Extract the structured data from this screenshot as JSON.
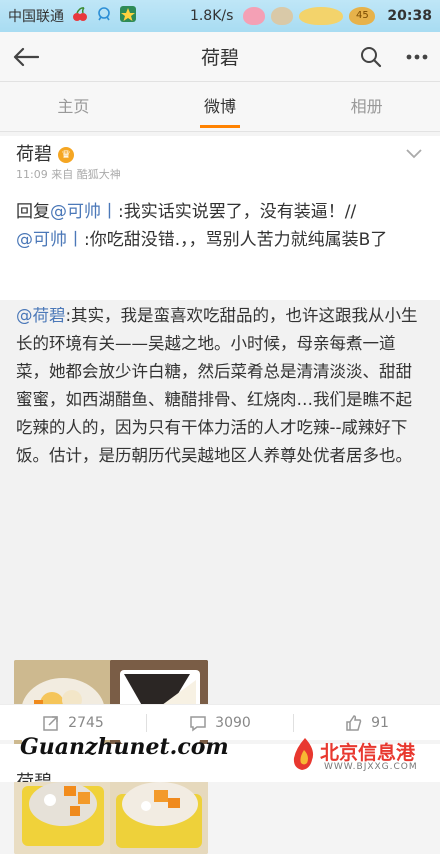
{
  "status_bar": {
    "carrier": "中国联通",
    "speed": "1.8K/s",
    "badge_45": "45",
    "time": "20:38"
  },
  "topbar": {
    "title": "荷碧"
  },
  "tabs": [
    {
      "label": "主页"
    },
    {
      "label": "微博"
    },
    {
      "label": "相册"
    }
  ],
  "post": {
    "author": "荷碧",
    "vip_badge": "♛",
    "meta": "11:09 来自 酷狐大神",
    "reply_prefix": "回复",
    "mention_1": "@可帅丨",
    "text_1": ":我实话实说罢了，没有装逼！//",
    "mention_2": "@可帅丨",
    "text_2": ":你吃甜没错.，，骂别人苦力就纯属装B了"
  },
  "quoted": {
    "mention": "@荷碧",
    "text": ":其实，我是蛮喜欢吃甜品的，也许这跟我从小生长的环境有关——吴越之地。小时候，母亲每煮一道菜，她都会放少许白糖，然后菜肴总是清清淡淡、甜甜蜜蜜，如西湖醋鱼、糖醋排骨、红烧肉…我们是瞧不起吃辣的人的，因为只有干体力活的人才吃辣--咸辣好下饭。估计，是历朝历代吴越地区人养尊处优者居多也。",
    "photos": [
      "dessert-photo-1",
      "dessert-photo-2",
      "dessert-photo-3",
      "dessert-photo-4"
    ]
  },
  "actions": {
    "repost_count": "2745",
    "comment_count": "3090",
    "like_count": "91"
  },
  "next_post": {
    "author": "荷碧"
  },
  "watermark": {
    "site": "Guanzhunet.com",
    "logo_main": "北京信息港",
    "logo_sub": "WWW.BJXXG.COM"
  },
  "colors": {
    "accent": "#ff8200",
    "link": "#4b78b8",
    "status_bar": "#a8dcf2"
  }
}
